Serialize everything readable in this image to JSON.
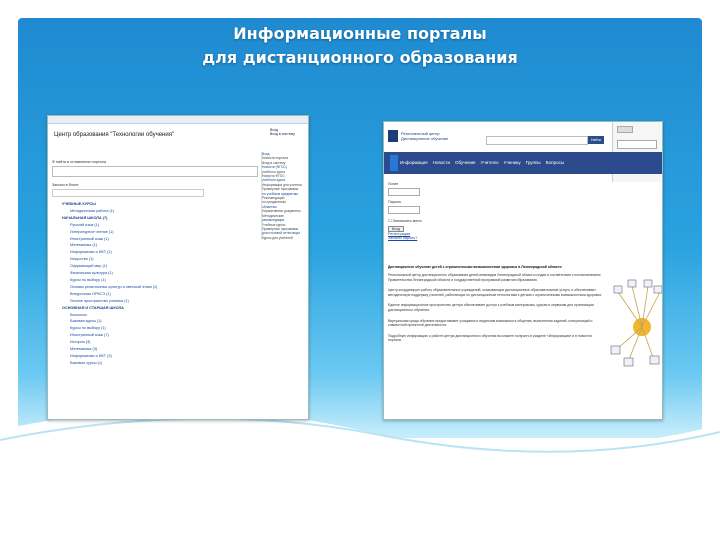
{
  "slide": {
    "title_line1": "Информационные порталы",
    "title_line2": "для дистанционного образования",
    "colors": {
      "banner_top": "#1f8ad0",
      "banner_bottom": "#c9eefb",
      "nav": "#2c4b8c"
    }
  },
  "shot1": {
    "heading": "Центр образования \"Технологии обучения\"",
    "search_label": "Ф найти  в оглавлении портала",
    "login_label": "Записи в блоге",
    "tree": [
      {
        "text": "УЧЕБНЫЕ КУРСЫ",
        "cat": true
      },
      {
        "text": "Методическая работа (1)",
        "cat": false
      },
      {
        "text": "НАЧАЛЬНАЯ ШКОЛА (7)",
        "cat": true
      },
      {
        "text": "Русский язык (1)",
        "cat": false
      },
      {
        "text": "Литературное чтение (1)",
        "cat": false
      },
      {
        "text": "Иностранный язык (1)",
        "cat": false
      },
      {
        "text": "Математика (1)",
        "cat": false
      },
      {
        "text": "Информатика и ИКТ (1)",
        "cat": false
      },
      {
        "text": "Искусство (1)",
        "cat": false
      },
      {
        "text": "Окружающий мир (1)",
        "cat": false
      },
      {
        "text": "Физическая культура (1)",
        "cat": false
      },
      {
        "text": "Курсы по выбору (1)",
        "cat": false
      },
      {
        "text": "Основы религиозных культур и светской этики (1)",
        "cat": false
      },
      {
        "text": "Внеурочная ОРКСЭ (1)",
        "cat": false
      },
      {
        "text": "Личное пространство ученика (1)",
        "cat": false
      },
      {
        "text": "ОСНОВНАЯ И СТАРШАЯ ШКОЛА",
        "cat": true
      },
      {
        "text": "Биология",
        "cat": false
      },
      {
        "text": "Базовая курсы (1)",
        "cat": false
      },
      {
        "text": "Курсы по выбору (1)",
        "cat": false
      },
      {
        "text": "Иностранный язык (7)",
        "cat": false
      },
      {
        "text": "История (3)",
        "cat": false
      },
      {
        "text": "Математика (3)",
        "cat": false
      },
      {
        "text": "Информатика и ИКТ (3)",
        "cat": false
      },
      {
        "text": "Базовые курсы (1)",
        "cat": false
      }
    ],
    "top_links": [
      "Вход",
      "Вход в систему"
    ],
    "right_column": [
      "Вход",
      "Новости портала",
      "Вход в систему",
      "Новости (ФГОС)",
      "учебного курса",
      "Новости ФГОС",
      "учебного курса",
      "Информация для учителя",
      "Примерные программы",
      "по учебным предметам",
      "Рекомендации",
      "по предметным",
      "областям",
      "Нормативные документы",
      "Методические",
      "рекомендации",
      "Учебные курсы",
      "Примерные программы",
      "для итоговой аттестации",
      "Курсы для учителей"
    ]
  },
  "shot2": {
    "brand_line1": "Региональный центр",
    "brand_line2": "Дистанционное обучение",
    "search_button": "Найти",
    "tabs": [
      "Информация",
      "Новости",
      "Обучение",
      "Учителю",
      "Ученику",
      "Группы",
      "Вопросы"
    ],
    "login_user": "Логин",
    "login_pass": "Пароль",
    "remember": "Запомнить меня",
    "login_button": "Вход",
    "register": "Регистрация",
    "forgot": "Забыли пароль?",
    "section_title": "Дистанционное обучение детей с ограниченными возможностями здоровья в Ленинградской области",
    "paragraphs": [
      "Региональный центр дистанционного образования детей-инвалидов Ленинградской области создан в соответствии с постановлением Правительства Ленинградской области и государственной программой развития образования.",
      "Центр координирует работу образовательных учреждений, оказывающих дистанционные образовательные услуги, и обеспечивает методическую поддержку учителей, работающих по дистанционным технологиям с детьми с ограниченными возможностями здоровья.",
      "Единое информационное пространство центра обеспечивает доступ к учебным материалам, курсам и сервисам для организации дистанционного обучения.",
      "Виртуальная среда обучения предоставляет учащимся и педагогам возможность общения, выполнения заданий, консультаций и совместной проектной деятельности.",
      "Подробную информацию о работе центра дистанционного обучения вы можете получить в разделе «Информация» и в новостях портала."
    ]
  }
}
